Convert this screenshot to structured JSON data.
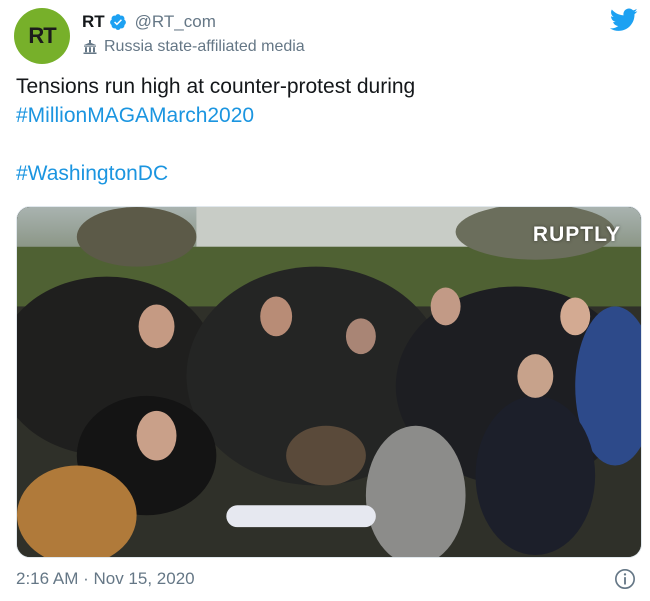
{
  "author": {
    "avatar_text": "RT",
    "name": "RT",
    "handle": "@RT_com",
    "label": "Russia state-affiliated media",
    "avatar_color": "#77b02a"
  },
  "tweet": {
    "lines": [
      "Tensions run high at counter-protest during",
      "#MillionMAGAMarch2020",
      "#WashingtonDC"
    ]
  },
  "media": {
    "watermark": "RUPTLY"
  },
  "footer": {
    "timestamp": "2:16 AM · Nov 15, 2020"
  },
  "icons": {
    "verified": "verified-badge-icon",
    "label": "government-building-icon",
    "brand": "twitter-bird-icon",
    "info": "info-icon"
  },
  "colors": {
    "link": "#1b95e0",
    "secondary_text": "#657786",
    "twitter_blue": "#1da1f2"
  }
}
